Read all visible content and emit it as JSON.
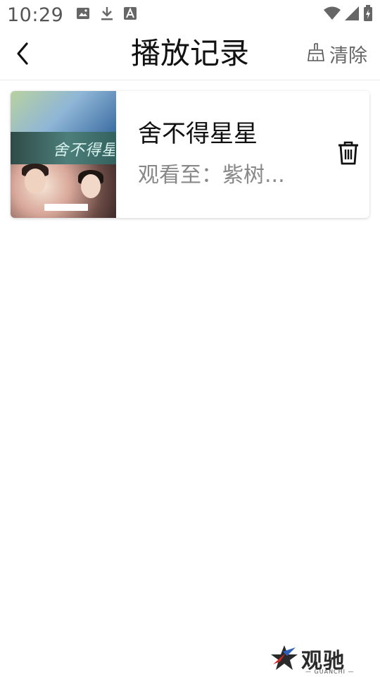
{
  "status_bar": {
    "time": "10:29",
    "left_icons": [
      "image-icon",
      "download-icon",
      "font-app-icon"
    ],
    "right_icons": [
      "wifi-icon",
      "signal-icon",
      "battery-icon"
    ]
  },
  "header": {
    "back_icon": "chevron-left-icon",
    "title": "播放记录",
    "clear_label": "清除",
    "clear_icon": "broom-icon"
  },
  "history": [
    {
      "title": "舍不得星星",
      "progress": "观看至：紫树...",
      "thumbnail_script": "舍不得星星",
      "delete_icon": "trash-icon"
    }
  ],
  "watermark": {
    "text": "观驰",
    "sub": "— GUANCHI —"
  },
  "colors": {
    "title_text": "#111111",
    "secondary_text": "#888888",
    "divider": "#ececec"
  }
}
